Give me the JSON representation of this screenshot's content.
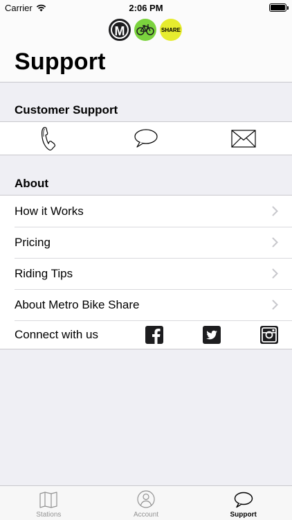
{
  "status_bar": {
    "carrier": "Carrier",
    "time": "2:06 PM"
  },
  "header": {
    "title": "Support",
    "logo_m": "M",
    "logo_share": "SHARE"
  },
  "customer_support": {
    "heading": "Customer Support",
    "actions": [
      {
        "name": "phone-icon"
      },
      {
        "name": "chat-icon"
      },
      {
        "name": "mail-icon"
      }
    ]
  },
  "about": {
    "heading": "About",
    "items": [
      {
        "label": "How it Works"
      },
      {
        "label": "Pricing"
      },
      {
        "label": "Riding Tips"
      },
      {
        "label": "About Metro Bike Share"
      }
    ],
    "connect_label": "Connect with us",
    "social": [
      "facebook-icon",
      "twitter-icon",
      "instagram-icon"
    ]
  },
  "tabbar": {
    "tabs": [
      {
        "label": "Stations",
        "icon": "map-icon",
        "active": false
      },
      {
        "label": "Account",
        "icon": "person-icon",
        "active": false
      },
      {
        "label": "Support",
        "icon": "chat-bubble-icon",
        "active": true
      }
    ]
  },
  "colors": {
    "background": "#efeff4",
    "bike_logo": "#7bd33e",
    "share_logo": "#e6ec2f",
    "inactive_tab": "#929292"
  }
}
